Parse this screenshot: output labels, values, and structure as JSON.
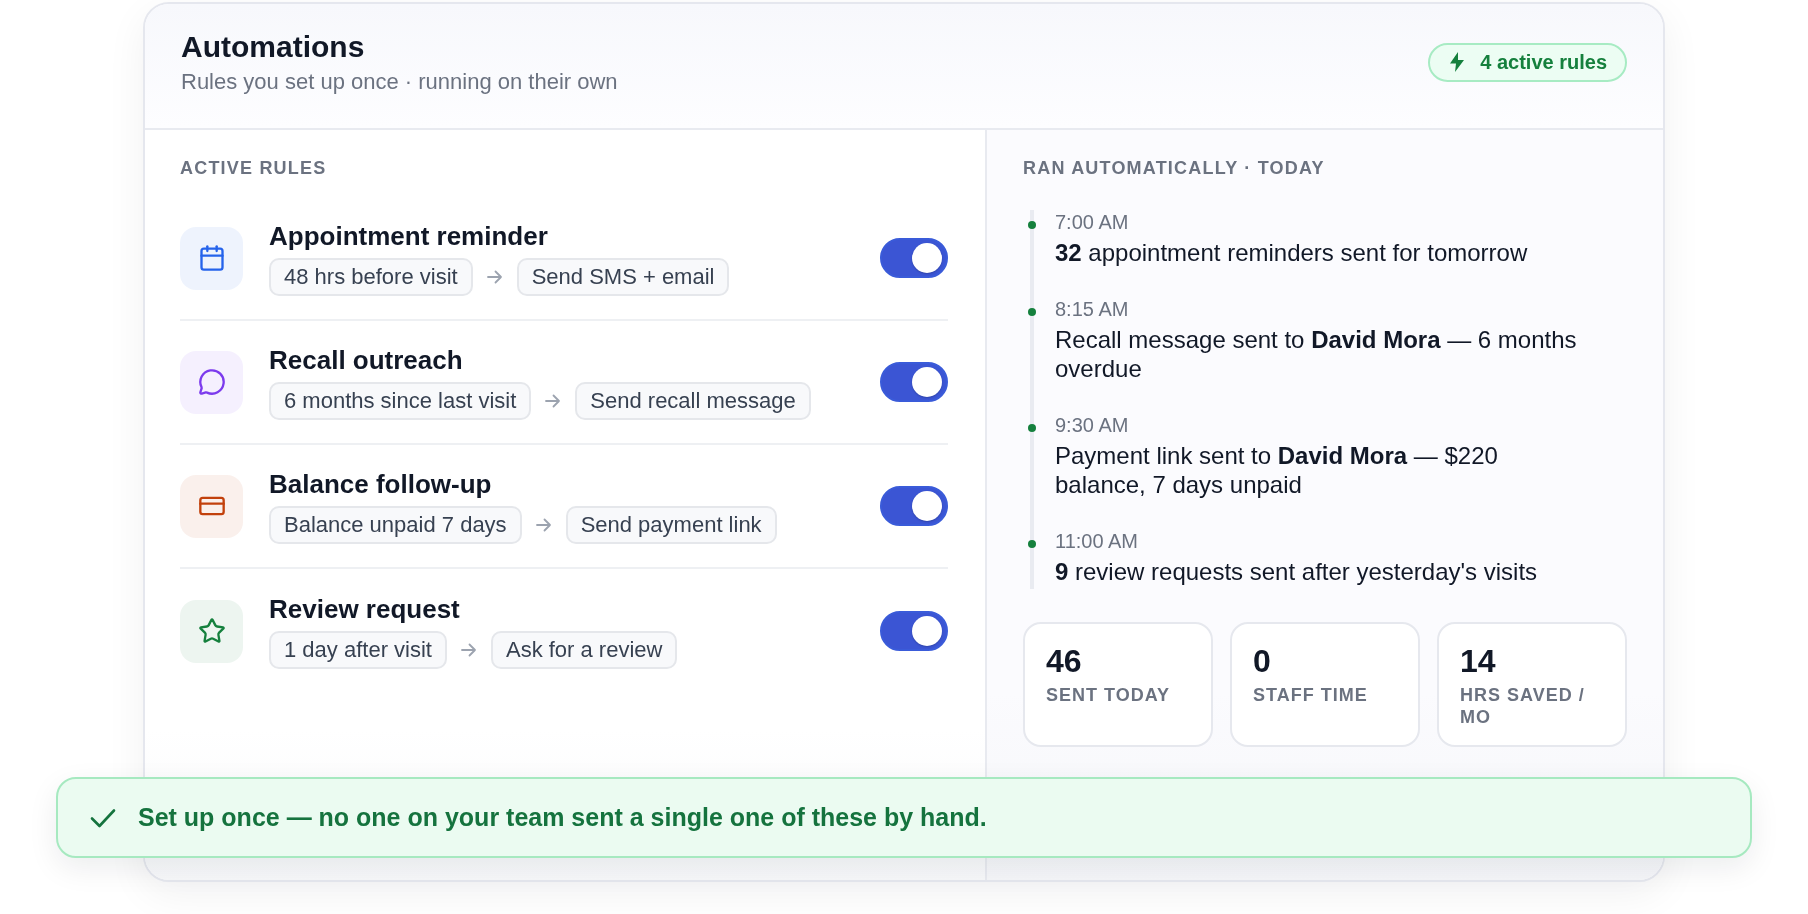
{
  "header": {
    "title": "Automations",
    "subtitle": "Rules you set up once · running on their own",
    "badge": "4 active rules"
  },
  "rules": {
    "heading": "ACTIVE RULES",
    "items": [
      {
        "name": "Appointment reminder",
        "trigger": "48 hrs before visit",
        "action": "Send SMS + email",
        "color": "#2563eb",
        "on": true
      },
      {
        "name": "Recall outreach",
        "trigger": "6 months since last visit",
        "action": "Send recall message",
        "color": "#7c3aed",
        "on": true
      },
      {
        "name": "Balance follow-up",
        "trigger": "Balance unpaid 7 days",
        "action": "Send payment link",
        "color": "#c2410c",
        "on": true
      },
      {
        "name": "Review request",
        "trigger": "1 day after visit",
        "action": "Ask for a review",
        "color": "#15803d",
        "on": true
      }
    ]
  },
  "activity": {
    "heading": "RAN AUTOMATICALLY · TODAY",
    "events": [
      {
        "time": "7:00 AM",
        "text": "**32** appointment reminders sent for tomorrow"
      },
      {
        "time": "8:15 AM",
        "text": "Recall message sent to **David Mora** — 6 months overdue"
      },
      {
        "time": "9:30 AM",
        "text": "Payment link sent to **David Mora** — $220 balance, 7 days unpaid"
      },
      {
        "time": "11:00 AM",
        "text": "**9** review requests sent after yesterday's visits"
      }
    ]
  },
  "stats": [
    {
      "value": "46",
      "label": "SENT TODAY"
    },
    {
      "value": "0",
      "label": "STAFF TIME"
    },
    {
      "value": "14",
      "label": "HRS SAVED / MO"
    }
  ],
  "banner": {
    "text": "Set up once — no one on your team sent a single one of these by hand."
  }
}
